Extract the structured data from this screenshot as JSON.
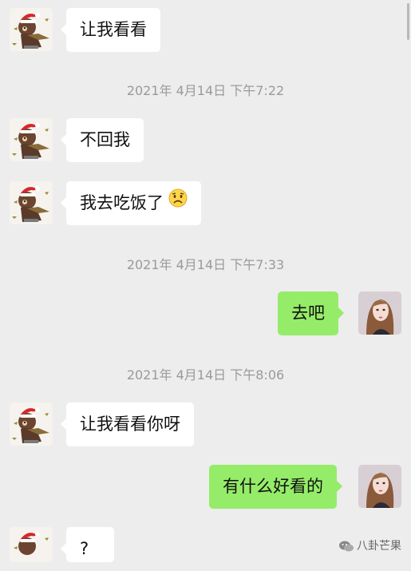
{
  "messages": [
    {
      "type": "message",
      "side": "left",
      "text": "让我看看",
      "avatar": "bear-avatar"
    },
    {
      "type": "time",
      "text": "2021年 4月14日 下午7:22"
    },
    {
      "type": "message",
      "side": "left",
      "text": "不回我",
      "avatar": "bear-avatar"
    },
    {
      "type": "message",
      "side": "left",
      "text": "我去吃饭了",
      "emoji": "sad-face-emoji",
      "avatar": "bear-avatar"
    },
    {
      "type": "time",
      "text": "2021年 4月14日 下午7:33"
    },
    {
      "type": "message",
      "side": "right",
      "text": "去吧",
      "avatar": "girl-avatar"
    },
    {
      "type": "time",
      "text": "2021年 4月14日 下午8:06"
    },
    {
      "type": "message",
      "side": "left",
      "text": "让我看看你呀",
      "avatar": "bear-avatar"
    },
    {
      "type": "message",
      "side": "right",
      "text": "有什么好看的",
      "avatar": "girl-avatar"
    },
    {
      "type": "message",
      "side": "left",
      "text": "?",
      "avatar": "bear-avatar"
    }
  ],
  "watermark": {
    "text": "八卦芒果",
    "icon": "wechat-icon"
  },
  "colors": {
    "background": "#ededed",
    "incoming_bubble": "#ffffff",
    "outgoing_bubble": "#95ec69",
    "timestamp": "#9a9a9a"
  }
}
